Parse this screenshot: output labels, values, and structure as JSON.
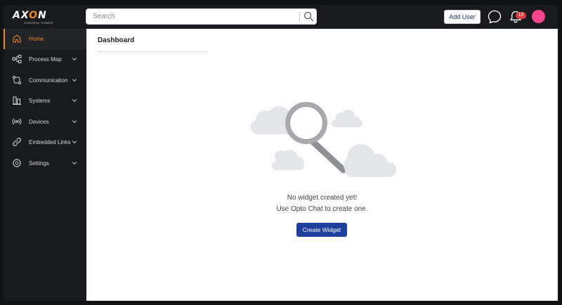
{
  "brand": {
    "name_prefix": "AX",
    "name_accent": "O",
    "name_suffix": "N",
    "tagline": "CONTROL TOWER"
  },
  "header": {
    "search_placeholder": "Search",
    "add_user_label": "Add User",
    "notification_count": "15"
  },
  "sidebar": {
    "items": [
      {
        "label": "Home",
        "icon": "home-icon",
        "active": true
      },
      {
        "label": "Process Map",
        "icon": "process-map-icon",
        "has_submenu": true
      },
      {
        "label": "Communication",
        "icon": "communication-icon",
        "has_submenu": true
      },
      {
        "label": "Systems",
        "icon": "systems-icon",
        "has_submenu": true
      },
      {
        "label": "Devices",
        "icon": "devices-icon",
        "has_submenu": true
      },
      {
        "label": "Embedded Links",
        "icon": "link-icon",
        "has_submenu": true
      },
      {
        "label": "Settings",
        "icon": "settings-icon",
        "has_submenu": true
      }
    ]
  },
  "main": {
    "title": "Dashboard",
    "empty_state": {
      "line1": "No widget created yet!",
      "line2": "Use Opto Chat to create one.",
      "button_label": "Create Widget",
      "illustration": "magnifier-clouds-illustration"
    }
  },
  "colors": {
    "accent": "#f08a24",
    "primary_button": "#1f3f9f",
    "avatar": "#f2448f",
    "badge": "#e23b3b",
    "sidebar_bg": "#191a1d"
  }
}
